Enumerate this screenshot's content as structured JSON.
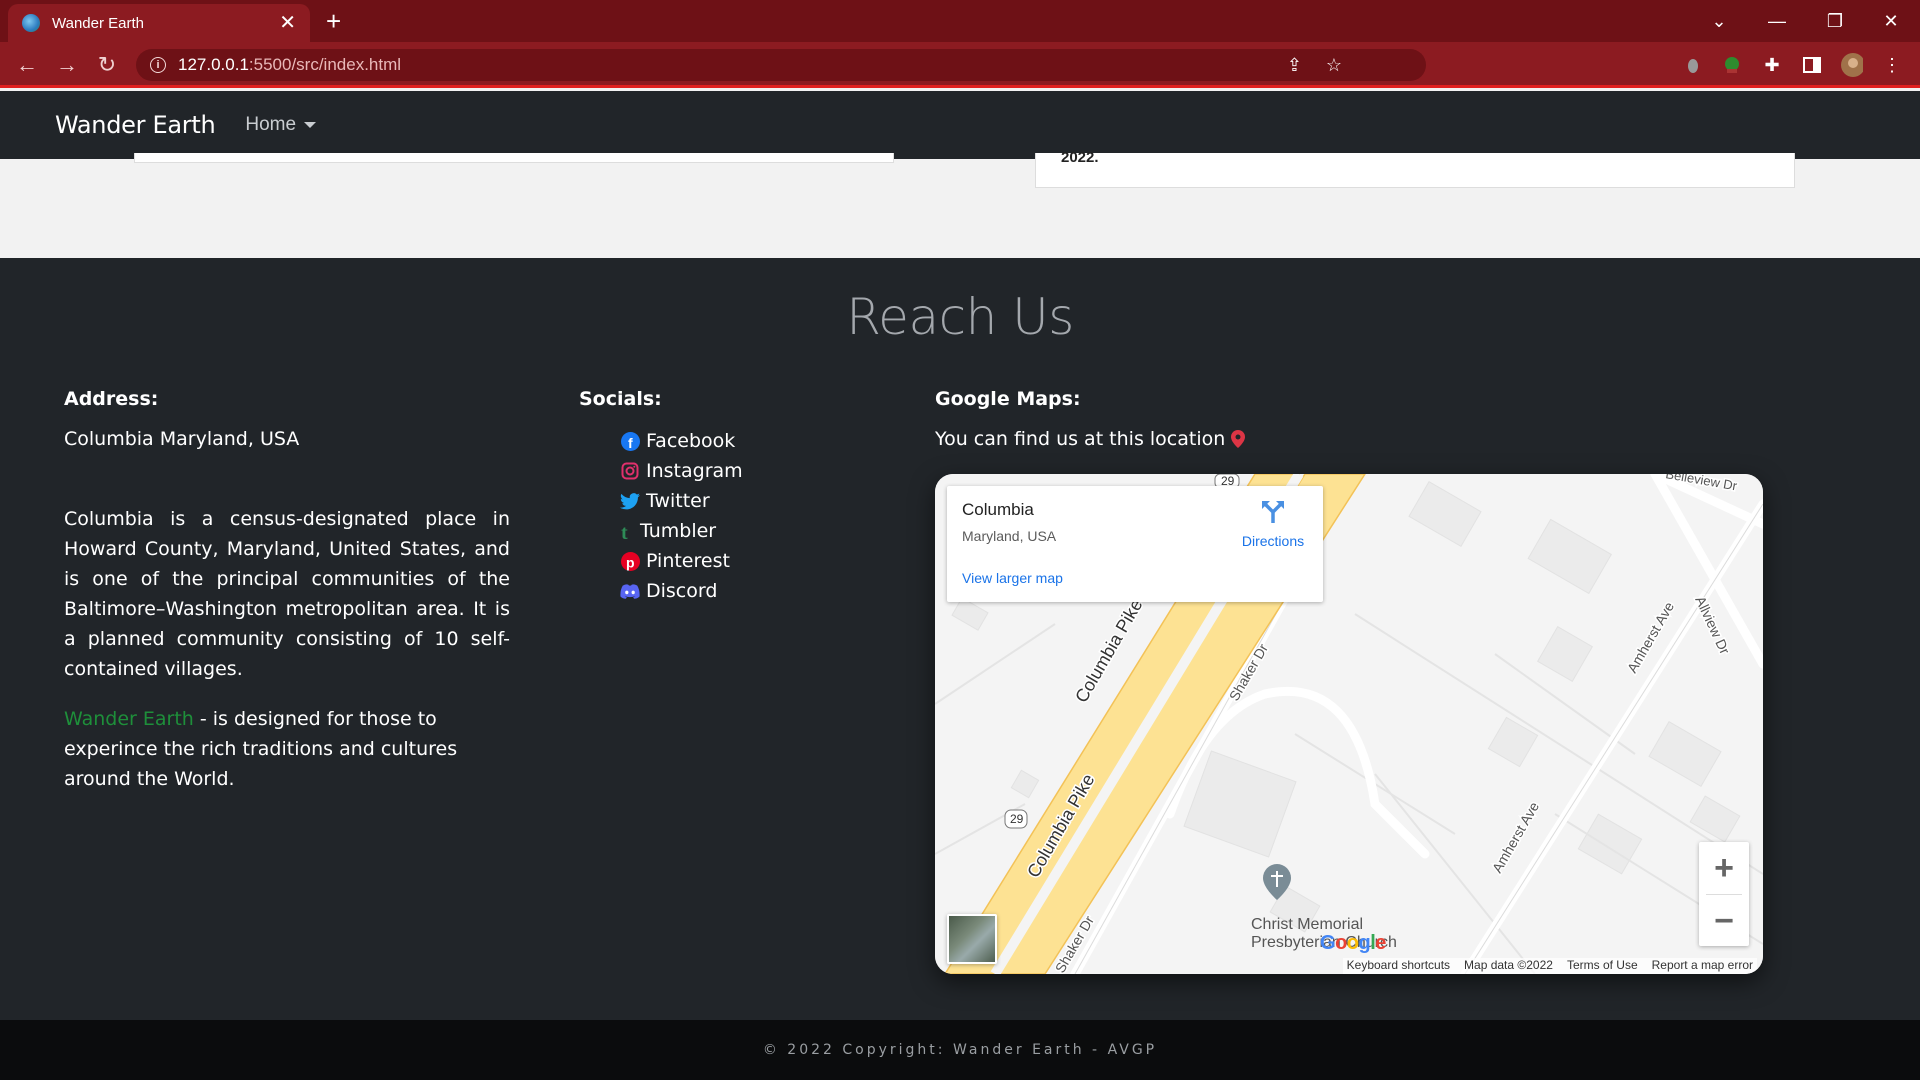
{
  "browser": {
    "tab_title": "Wander Earth",
    "url_host": "127.0.0.1",
    "url_rest": ":5500/src/index.html"
  },
  "navbar": {
    "brand": "Wander Earth",
    "home_label": "Home"
  },
  "content": {
    "card_right_fragment": "2022."
  },
  "footer": {
    "title": "Reach Us",
    "address": {
      "heading": "Address:",
      "line": "Columbia Maryland, USA",
      "about": "Columbia is a census-designated place in Howard County, Maryland, United States, and is one of the principal communities of the Baltimore–Washington metropolitan area. It is a planned community consisting of 10 self-contained villages.",
      "brand_link": "Wander Earth",
      "designed": " - is designed for those to experince the rich traditions and cultures around the World."
    },
    "socials": {
      "heading": "Socials:",
      "items": [
        {
          "label": "Facebook",
          "icon": "facebook-icon",
          "color": "#1877f2"
        },
        {
          "label": "Instagram",
          "icon": "instagram-icon",
          "color": "#e1306c"
        },
        {
          "label": "Twitter",
          "icon": "twitter-icon",
          "color": "#1da1f2"
        },
        {
          "label": "Tumbler",
          "icon": "tumblr-icon",
          "color": "#2e8b57"
        },
        {
          "label": "Pinterest",
          "icon": "pinterest-icon",
          "color": "#e60023"
        },
        {
          "label": "Discord",
          "icon": "discord-icon",
          "color": "#5865f2"
        }
      ]
    },
    "maps": {
      "heading": "Google Maps:",
      "text": "You can find us at this location",
      "place_title": "Columbia",
      "place_sub": "Maryland, USA",
      "directions": "Directions",
      "view_larger": "View larger map",
      "road_1": "Columbia Pike",
      "road_2": "Columbia Pike",
      "shaker": "Shaker Dr",
      "shaker_2": "Shaker Dr",
      "amherst_1": "Amherst Ave",
      "amherst_2": "Amherst Ave",
      "allview": "Allview Dr",
      "belleview": "Belleview Dr",
      "route": "29",
      "church_line1": "Christ Memorial",
      "church_line2": "Presbyterian Church",
      "google": "Google",
      "footer_links": [
        "Keyboard shortcuts",
        "Map data ©2022",
        "Terms of Use",
        "Report a map error"
      ]
    }
  },
  "copyright": "© 2022 Copyright: Wander Earth - AVGP",
  "colors": {
    "chrome_dark": "#6e1116",
    "chrome": "#8c1b21",
    "navbar": "#212529",
    "brand_link": "#1e8f3a"
  }
}
